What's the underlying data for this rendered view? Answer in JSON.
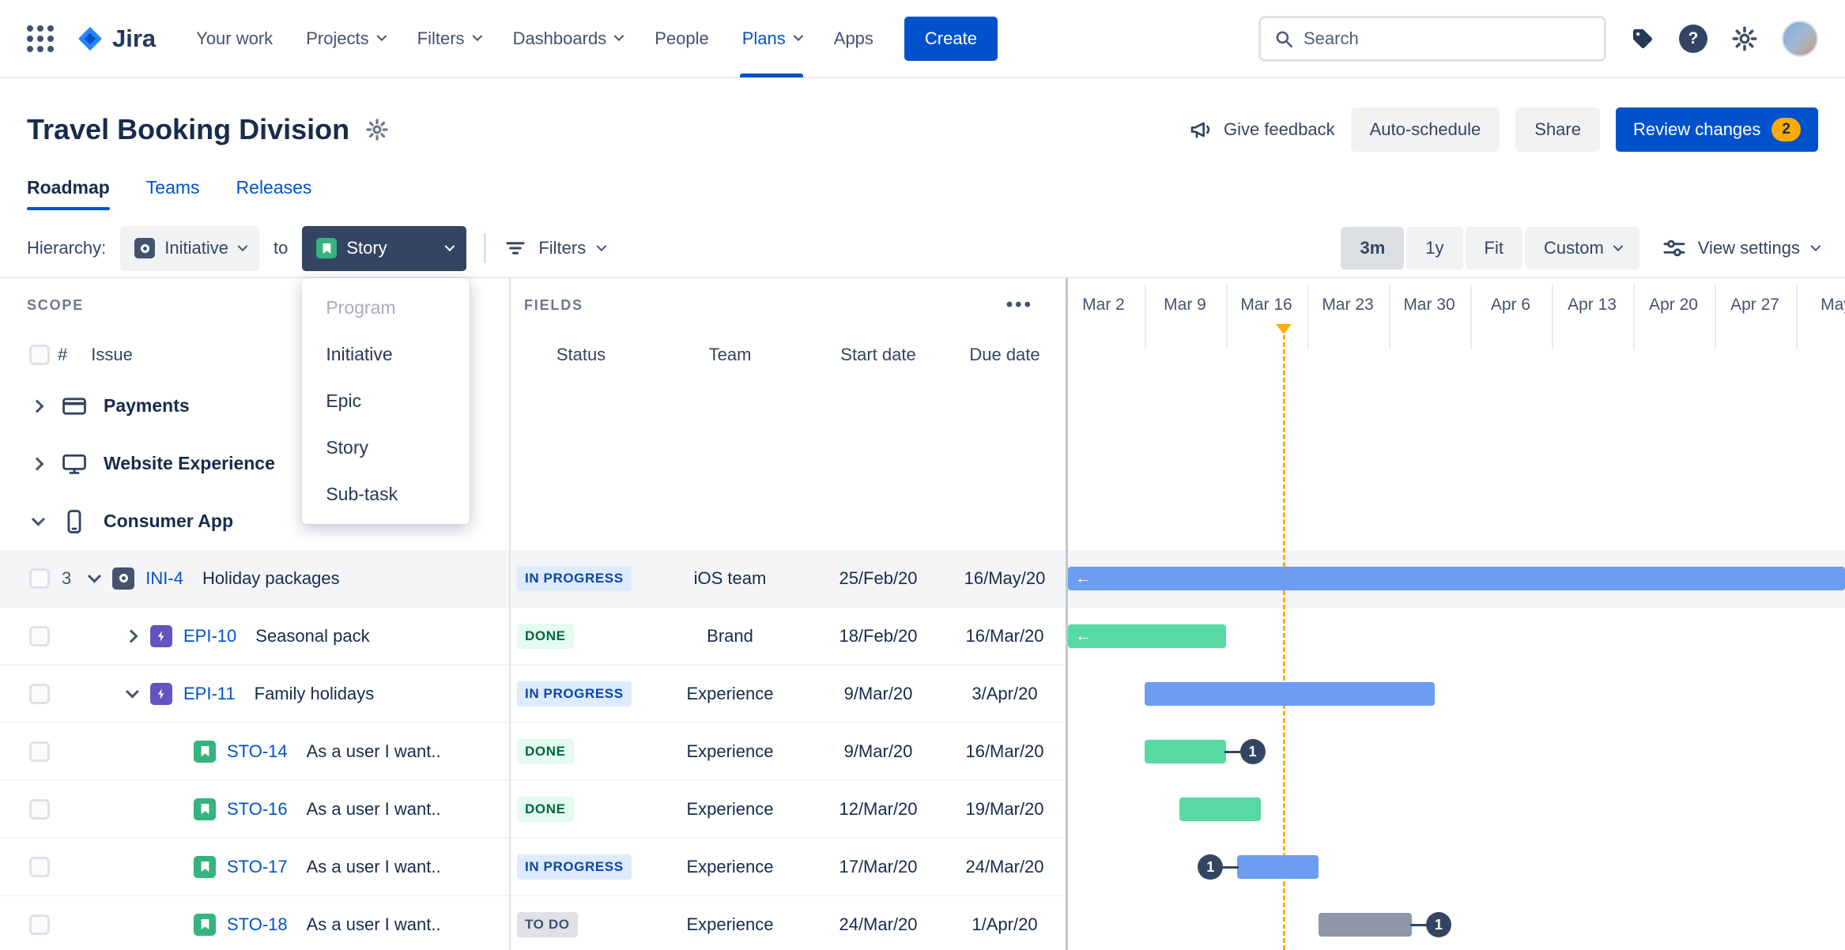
{
  "brand": {
    "app_name": "Jira"
  },
  "palette": {
    "accent": "#0052CC",
    "bar_blue": "#6C9DF1",
    "bar_green": "#57D9A3",
    "bar_gray": "#8C96A8",
    "today_marker": "#FFAB00",
    "review_badge": "#FFAB00",
    "status_inprogress_bg": "#DEEBFF",
    "status_done_bg": "#E3FCEF",
    "status_todo_bg": "#DFE1E6"
  },
  "topnav": {
    "items": [
      {
        "label": "Your work",
        "dropdown": false,
        "active": false
      },
      {
        "label": "Projects",
        "dropdown": true,
        "active": false
      },
      {
        "label": "Filters",
        "dropdown": true,
        "active": false
      },
      {
        "label": "Dashboards",
        "dropdown": true,
        "active": false
      },
      {
        "label": "People",
        "dropdown": false,
        "active": false
      },
      {
        "label": "Plans",
        "dropdown": true,
        "active": true
      },
      {
        "label": "Apps",
        "dropdown": false,
        "active": false
      }
    ],
    "create_label": "Create",
    "search_placeholder": "Search",
    "help_glyph": "?"
  },
  "page": {
    "title": "Travel Booking Division"
  },
  "actions": {
    "give_feedback": "Give feedback",
    "auto_schedule": "Auto-schedule",
    "share": "Share",
    "review_changes": "Review changes",
    "review_badge": "2"
  },
  "tabs": [
    {
      "label": "Roadmap",
      "active": true
    },
    {
      "label": "Teams",
      "active": false
    },
    {
      "label": "Releases",
      "active": false
    }
  ],
  "toolbar": {
    "hierarchy_label": "Hierarchy:",
    "from_value": "Initiative",
    "to_word": "to",
    "to_value": "Story",
    "filters_label": "Filters",
    "zoom_options": [
      "3m",
      "1y",
      "Fit"
    ],
    "zoom_active": "3m",
    "custom_label": "Custom",
    "view_settings_label": "View settings"
  },
  "hierarchy_dropdown": {
    "items": [
      {
        "label": "Program",
        "disabled": true
      },
      {
        "label": "Initiative",
        "disabled": false
      },
      {
        "label": "Epic",
        "disabled": false
      },
      {
        "label": "Story",
        "disabled": false
      },
      {
        "label": "Sub-task",
        "disabled": false
      }
    ]
  },
  "scope": {
    "section_label": "SCOPE",
    "hash_header": "#",
    "issue_header": "Issue",
    "groups": [
      {
        "label": "Payments",
        "icon": "credit-card",
        "expanded": false
      },
      {
        "label": "Website Experience",
        "icon": "monitor",
        "expanded": false
      },
      {
        "label": "Consumer App",
        "icon": "mobile",
        "expanded": true
      }
    ]
  },
  "fields": {
    "section_label": "FIELDS",
    "more_label": "•••",
    "columns": [
      "Status",
      "Team",
      "Start date",
      "Due date"
    ]
  },
  "timeline": {
    "ticks": [
      "Mar 2",
      "Mar 9",
      "Mar 16",
      "Mar 23",
      "Mar 30",
      "Apr 6",
      "Apr 13",
      "Apr 20",
      "Apr 27",
      "May"
    ]
  },
  "rows": [
    {
      "type": "initiative",
      "count": "3",
      "expander": "down",
      "key": "INI-4",
      "title": "Holiday packages",
      "status": "IN PROGRESS",
      "team": "iOS team",
      "start": "25/Feb/20",
      "due": "16/May/20",
      "bar": "blue",
      "shaded": true,
      "badge": null
    },
    {
      "type": "epic",
      "expander": "right",
      "key": "EPI-10",
      "title": "Seasonal pack",
      "status": "DONE",
      "team": "Brand",
      "start": "18/Feb/20",
      "due": "16/Mar/20",
      "bar": "green",
      "shaded": false,
      "badge": null
    },
    {
      "type": "epic",
      "expander": "down",
      "key": "EPI-11",
      "title": "Family holidays",
      "status": "IN PROGRESS",
      "team": "Experience",
      "start": "9/Mar/20",
      "due": "3/Apr/20",
      "bar": "blue",
      "shaded": false,
      "badge": null
    },
    {
      "type": "story",
      "expander": null,
      "key": "STO-14",
      "title": "As a user I want..",
      "status": "DONE",
      "team": "Experience",
      "start": "9/Mar/20",
      "due": "16/Mar/20",
      "bar": "green",
      "shaded": false,
      "badge": {
        "side": "right",
        "label": "1"
      }
    },
    {
      "type": "story",
      "expander": null,
      "key": "STO-16",
      "title": "As a user I want..",
      "status": "DONE",
      "team": "Experience",
      "start": "12/Mar/20",
      "due": "19/Mar/20",
      "bar": "green",
      "shaded": false,
      "badge": null
    },
    {
      "type": "story",
      "expander": null,
      "key": "STO-17",
      "title": "As a user I want..",
      "status": "IN PROGRESS",
      "team": "Experience",
      "start": "17/Mar/20",
      "due": "24/Mar/20",
      "bar": "blue",
      "shaded": false,
      "badge": {
        "side": "left",
        "label": "1"
      }
    },
    {
      "type": "story",
      "expander": null,
      "key": "STO-18",
      "title": "As a user I want..",
      "status": "TO DO",
      "team": "Experience",
      "start": "24/Mar/20",
      "due": "1/Apr/20",
      "bar": "gray",
      "shaded": false,
      "badge": {
        "side": "right",
        "label": "1"
      }
    }
  ]
}
